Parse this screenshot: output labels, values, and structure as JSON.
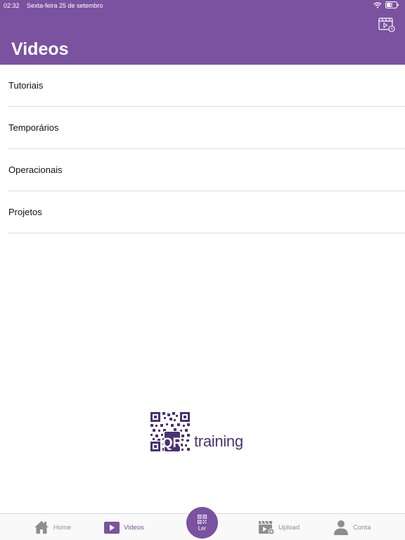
{
  "status_bar": {
    "time": "02:32",
    "date": "Sexta-feira 25 de setembro"
  },
  "header": {
    "title": "Videos",
    "action_icon": "video-clock-icon"
  },
  "categories": [
    {
      "label": "Tutoriais"
    },
    {
      "label": "Temporários"
    },
    {
      "label": "Operacionais"
    },
    {
      "label": "Projetos"
    }
  ],
  "brand": {
    "logo_mark": "QR",
    "text": "training"
  },
  "tabbar": {
    "home": {
      "label": "Home",
      "icon": "house-icon"
    },
    "videos": {
      "label": "Videos",
      "icon": "play-icon"
    },
    "scan": {
      "label": "Ler",
      "icon": "qr-code-icon"
    },
    "upload": {
      "label": "Upload",
      "icon": "clapper-upload-icon"
    },
    "account": {
      "label": "Conta",
      "icon": "person-icon"
    }
  },
  "colors": {
    "accent": "#7a52a0",
    "brand_dark": "#4a3272",
    "inactive": "#8e8e8e"
  }
}
